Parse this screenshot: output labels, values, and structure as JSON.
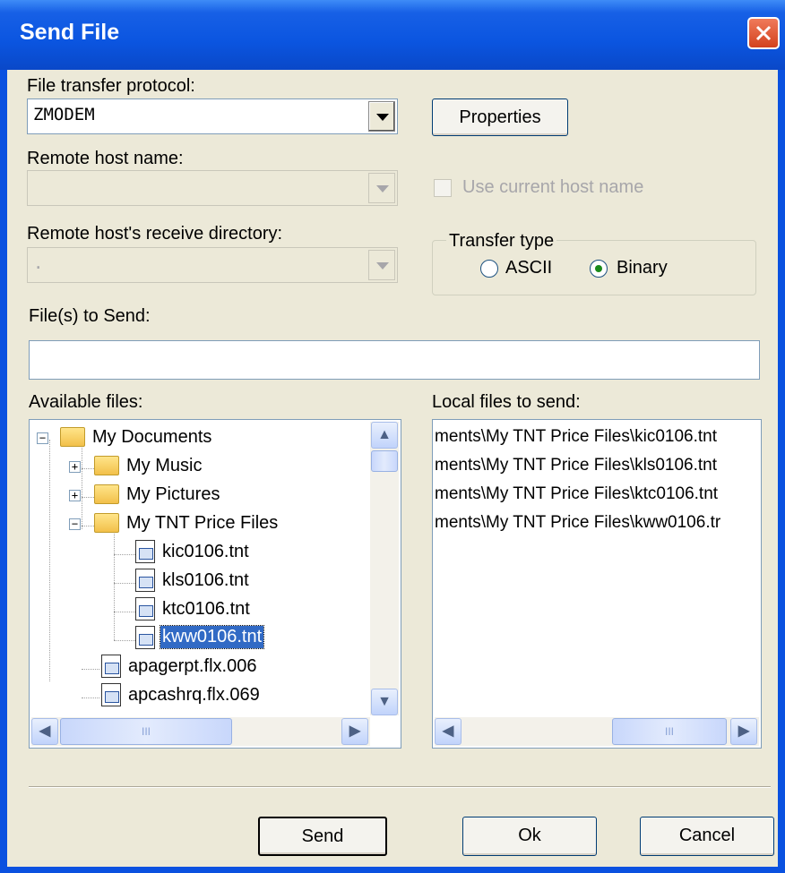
{
  "window": {
    "title": "Send File"
  },
  "protocol": {
    "label": "File transfer protocol:",
    "value": "ZMODEM",
    "properties_label": "Properties"
  },
  "host": {
    "label": "Remote host name:",
    "value": "",
    "use_current_label": "Use current host name",
    "use_current_checked": false
  },
  "receive_dir": {
    "label": "Remote host's receive directory:",
    "value": "."
  },
  "transfer_type": {
    "title": "Transfer type",
    "options": [
      "ASCII",
      "Binary"
    ],
    "selected": "Binary"
  },
  "files_to_send": {
    "label": "File(s) to Send:",
    "value": ""
  },
  "available_files": {
    "label": "Available files:",
    "items": [
      {
        "name": "My Documents",
        "kind": "folder",
        "expanded": true
      },
      {
        "name": "My Music",
        "kind": "folder",
        "expanded": false
      },
      {
        "name": "My Pictures",
        "kind": "folder",
        "expanded": false
      },
      {
        "name": "My TNT Price Files",
        "kind": "folder",
        "expanded": true
      },
      {
        "name": "kic0106.tnt",
        "kind": "file"
      },
      {
        "name": "kls0106.tnt",
        "kind": "file"
      },
      {
        "name": "ktc0106.tnt",
        "kind": "file"
      },
      {
        "name": "kww0106.tnt",
        "kind": "file",
        "selected": true
      },
      {
        "name": "apagerpt.flx.006",
        "kind": "file"
      },
      {
        "name": "apcashrq.flx.069",
        "kind": "file"
      }
    ]
  },
  "local_files": {
    "label": "Local files to send:",
    "items": [
      "ments\\My TNT Price Files\\kic0106.tnt",
      "ments\\My TNT Price Files\\kls0106.tnt",
      "ments\\My TNT Price Files\\ktc0106.tnt",
      "ments\\My TNT Price Files\\kww0106.tr"
    ]
  },
  "buttons": {
    "send": "Send",
    "ok": "Ok",
    "cancel": "Cancel"
  },
  "scrollbar_thumb_label": "III",
  "colors": {
    "titlebar": "#0a51e0",
    "dialog": "#ece9d8",
    "selection": "#316ac5"
  }
}
